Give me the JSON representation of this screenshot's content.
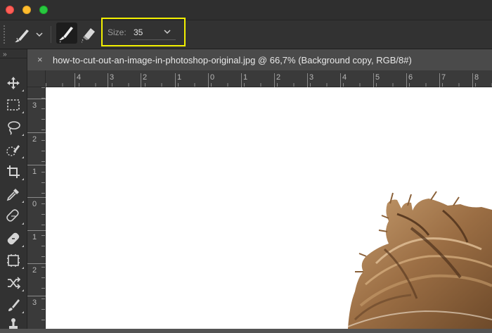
{
  "window": {
    "controls": [
      "close-button",
      "minimize-button",
      "zoom-button"
    ]
  },
  "options_bar": {
    "tool_preset_icon": "brush-preset-icon",
    "modes": [
      {
        "name": "brush-mode-icon",
        "active": true
      },
      {
        "name": "eraser-mode-icon",
        "active": false
      }
    ],
    "size": {
      "label": "Size:",
      "value": "35"
    },
    "highlight_color": "#f3f000"
  },
  "toolbar": {
    "collapse": "››",
    "tools": [
      "move-tool-icon",
      "marquee-tool-icon",
      "lasso-tool-icon",
      "quick-selection-tool-icon",
      "crop-tool-icon",
      "eyedropper-tool-icon",
      "spot-healing-tool-icon",
      "healing-brush-tool-icon",
      "patch-tool-icon",
      "content-aware-move-tool-icon",
      "brush-tool-icon",
      "clone-stamp-tool-icon"
    ]
  },
  "document": {
    "tab_close": "×",
    "title": "how-to-cut-out-an-image-in-photoshop-original.jpg @ 66,7% (Background copy, RGB/8#)"
  },
  "rulers": {
    "horizontal_labels": [
      "4",
      "3",
      "2",
      "1",
      "0",
      "1",
      "2",
      "3",
      "4",
      "5",
      "6",
      "7",
      "8"
    ],
    "vertical_labels": [
      "3",
      "2",
      "1",
      "0",
      "1",
      "2",
      "3"
    ]
  },
  "canvas": {
    "background_color": "#ffffff",
    "subject": "hair-cutout-image"
  }
}
